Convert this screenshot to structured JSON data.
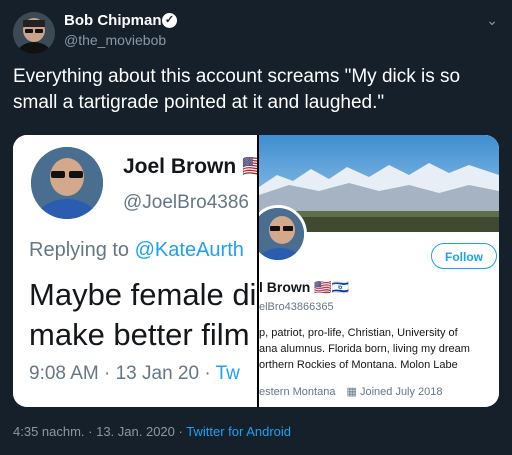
{
  "tweet": {
    "author_name": "Bob Chipman",
    "author_handle": "@the_moviebob",
    "text": "Everything about this account screams \"My dick is so small a tartigrade pointed at it and laughed.\"",
    "timestamp": "4:35 nachm. · 13. Jan. 2020",
    "separator": "·",
    "source": "Twitter for Android"
  },
  "screenshot_left": {
    "name": "Joel Brown 🇺🇸",
    "handle": "@JoelBro4386",
    "replying_prefix": "Replying to ",
    "replying_mention": "@KateAurth",
    "body_line1": "Maybe female di",
    "body_line2": "make better film",
    "time": "9:08 AM · 13 Jan 20 · ",
    "time_source": "Tw"
  },
  "screenshot_right": {
    "follow_label": "Follow",
    "name": "l Brown 🇺🇸🇮🇱",
    "handle": "elBro43866365",
    "bio_line1": "p, patriot, pro-life, Christian, University of",
    "bio_line2": "ana alumnus. Florida born, living my dream",
    "bio_line3": "orthern Rockies of Montana. Molon Labe",
    "location": "estern Montana",
    "joined": "Joined July 2018"
  },
  "icons": {
    "verified": "verified-badge-icon",
    "chevron": "chevron-down-icon",
    "calendar": "calendar-icon"
  },
  "colors": {
    "background": "#15202b",
    "accent": "#1da1f2",
    "secondary_text": "#8899a6"
  }
}
